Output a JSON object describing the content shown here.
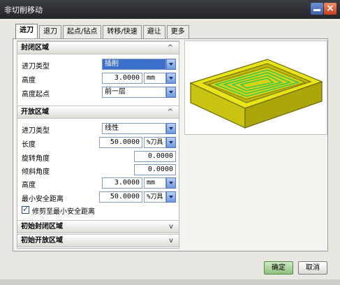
{
  "window": {
    "title": "非切削移动"
  },
  "tabs": [
    {
      "label": "进刀",
      "active": true
    },
    {
      "label": "退刀",
      "active": false
    },
    {
      "label": "起点/钻点",
      "active": false
    },
    {
      "label": "转移/快速",
      "active": false
    },
    {
      "label": "避让",
      "active": false
    },
    {
      "label": "更多",
      "active": false
    }
  ],
  "closed_area": {
    "header": "封闭区域",
    "toggle": "^",
    "entry_type_label": "进刀类型",
    "entry_type_value": "插削",
    "height_label": "高度",
    "height_value": "3.0000",
    "height_unit": "mm",
    "height_from_label": "高度起点",
    "height_from_value": "前一层"
  },
  "open_area": {
    "header": "开放区域",
    "toggle": "^",
    "entry_type_label": "进刀类型",
    "entry_type_value": "线性",
    "length_label": "长度",
    "length_value": "50.0000",
    "length_unit": "%刀具",
    "rotation_label": "旋转角度",
    "rotation_value": "0.0000",
    "ramp_label": "倾斜角度",
    "ramp_value": "0.0000",
    "height_label": "高度",
    "height_value": "3.0000",
    "height_unit": "mm",
    "min_clearance_label": "最小安全距离",
    "min_clearance_value": "50.0000",
    "min_clearance_unit": "%刀具",
    "trim_checkbox_label": "修剪至最小安全距离",
    "trim_checked": true
  },
  "initial_closed": {
    "header": "初始封闭区域",
    "toggle": "v"
  },
  "initial_open": {
    "header": "初始开放区域",
    "toggle": "v"
  },
  "buttons": {
    "ok": "确定",
    "cancel": "取消"
  },
  "colors": {
    "part_fill": "#e8e31a",
    "part_edge": "#6b6a05",
    "toolpath": "#1ec95a",
    "selection": "#3b6fcb"
  }
}
